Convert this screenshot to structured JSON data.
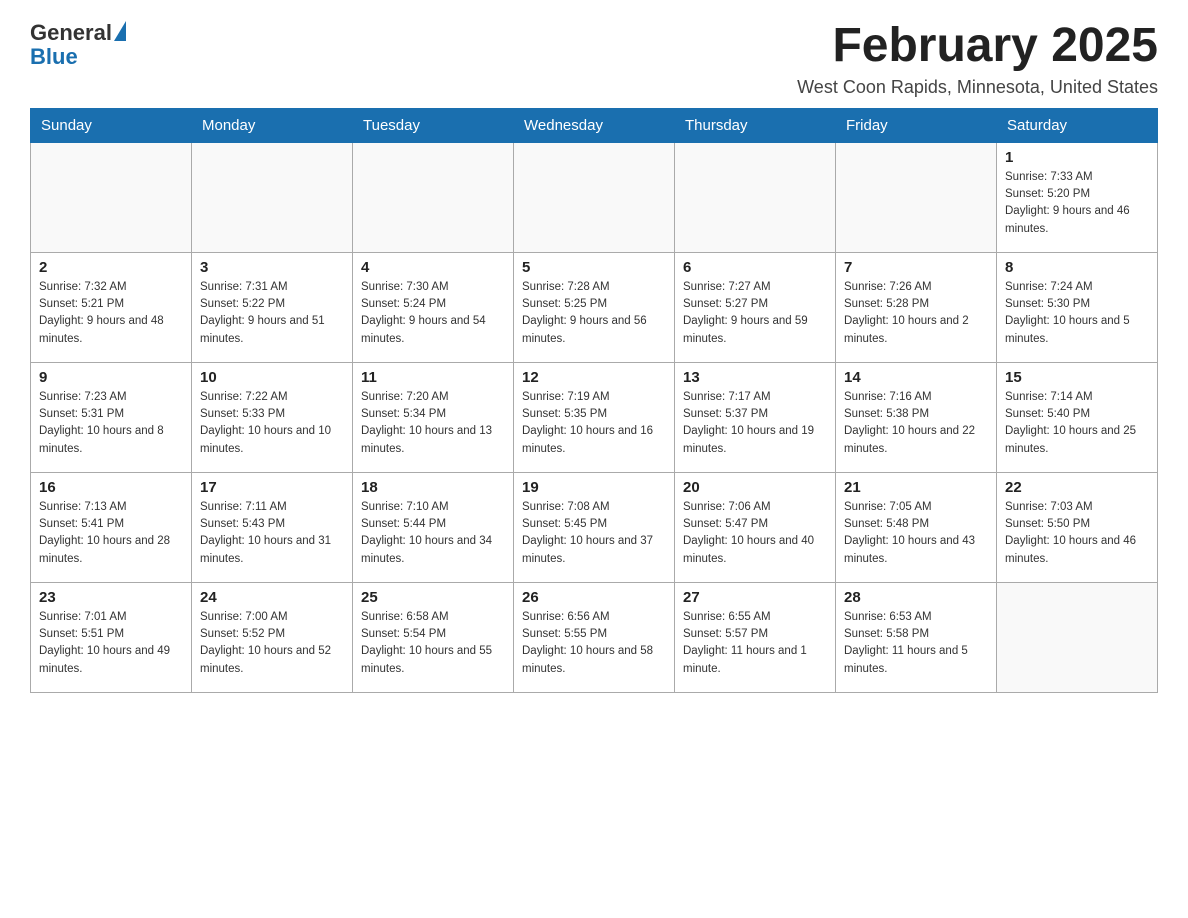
{
  "header": {
    "logo_general": "General",
    "logo_blue": "Blue",
    "month_year": "February 2025",
    "location": "West Coon Rapids, Minnesota, United States"
  },
  "days_of_week": [
    "Sunday",
    "Monday",
    "Tuesday",
    "Wednesday",
    "Thursday",
    "Friday",
    "Saturday"
  ],
  "weeks": [
    [
      {
        "day": "",
        "info": ""
      },
      {
        "day": "",
        "info": ""
      },
      {
        "day": "",
        "info": ""
      },
      {
        "day": "",
        "info": ""
      },
      {
        "day": "",
        "info": ""
      },
      {
        "day": "",
        "info": ""
      },
      {
        "day": "1",
        "info": "Sunrise: 7:33 AM\nSunset: 5:20 PM\nDaylight: 9 hours and 46 minutes."
      }
    ],
    [
      {
        "day": "2",
        "info": "Sunrise: 7:32 AM\nSunset: 5:21 PM\nDaylight: 9 hours and 48 minutes."
      },
      {
        "day": "3",
        "info": "Sunrise: 7:31 AM\nSunset: 5:22 PM\nDaylight: 9 hours and 51 minutes."
      },
      {
        "day": "4",
        "info": "Sunrise: 7:30 AM\nSunset: 5:24 PM\nDaylight: 9 hours and 54 minutes."
      },
      {
        "day": "5",
        "info": "Sunrise: 7:28 AM\nSunset: 5:25 PM\nDaylight: 9 hours and 56 minutes."
      },
      {
        "day": "6",
        "info": "Sunrise: 7:27 AM\nSunset: 5:27 PM\nDaylight: 9 hours and 59 minutes."
      },
      {
        "day": "7",
        "info": "Sunrise: 7:26 AM\nSunset: 5:28 PM\nDaylight: 10 hours and 2 minutes."
      },
      {
        "day": "8",
        "info": "Sunrise: 7:24 AM\nSunset: 5:30 PM\nDaylight: 10 hours and 5 minutes."
      }
    ],
    [
      {
        "day": "9",
        "info": "Sunrise: 7:23 AM\nSunset: 5:31 PM\nDaylight: 10 hours and 8 minutes."
      },
      {
        "day": "10",
        "info": "Sunrise: 7:22 AM\nSunset: 5:33 PM\nDaylight: 10 hours and 10 minutes."
      },
      {
        "day": "11",
        "info": "Sunrise: 7:20 AM\nSunset: 5:34 PM\nDaylight: 10 hours and 13 minutes."
      },
      {
        "day": "12",
        "info": "Sunrise: 7:19 AM\nSunset: 5:35 PM\nDaylight: 10 hours and 16 minutes."
      },
      {
        "day": "13",
        "info": "Sunrise: 7:17 AM\nSunset: 5:37 PM\nDaylight: 10 hours and 19 minutes."
      },
      {
        "day": "14",
        "info": "Sunrise: 7:16 AM\nSunset: 5:38 PM\nDaylight: 10 hours and 22 minutes."
      },
      {
        "day": "15",
        "info": "Sunrise: 7:14 AM\nSunset: 5:40 PM\nDaylight: 10 hours and 25 minutes."
      }
    ],
    [
      {
        "day": "16",
        "info": "Sunrise: 7:13 AM\nSunset: 5:41 PM\nDaylight: 10 hours and 28 minutes."
      },
      {
        "day": "17",
        "info": "Sunrise: 7:11 AM\nSunset: 5:43 PM\nDaylight: 10 hours and 31 minutes."
      },
      {
        "day": "18",
        "info": "Sunrise: 7:10 AM\nSunset: 5:44 PM\nDaylight: 10 hours and 34 minutes."
      },
      {
        "day": "19",
        "info": "Sunrise: 7:08 AM\nSunset: 5:45 PM\nDaylight: 10 hours and 37 minutes."
      },
      {
        "day": "20",
        "info": "Sunrise: 7:06 AM\nSunset: 5:47 PM\nDaylight: 10 hours and 40 minutes."
      },
      {
        "day": "21",
        "info": "Sunrise: 7:05 AM\nSunset: 5:48 PM\nDaylight: 10 hours and 43 minutes."
      },
      {
        "day": "22",
        "info": "Sunrise: 7:03 AM\nSunset: 5:50 PM\nDaylight: 10 hours and 46 minutes."
      }
    ],
    [
      {
        "day": "23",
        "info": "Sunrise: 7:01 AM\nSunset: 5:51 PM\nDaylight: 10 hours and 49 minutes."
      },
      {
        "day": "24",
        "info": "Sunrise: 7:00 AM\nSunset: 5:52 PM\nDaylight: 10 hours and 52 minutes."
      },
      {
        "day": "25",
        "info": "Sunrise: 6:58 AM\nSunset: 5:54 PM\nDaylight: 10 hours and 55 minutes."
      },
      {
        "day": "26",
        "info": "Sunrise: 6:56 AM\nSunset: 5:55 PM\nDaylight: 10 hours and 58 minutes."
      },
      {
        "day": "27",
        "info": "Sunrise: 6:55 AM\nSunset: 5:57 PM\nDaylight: 11 hours and 1 minute."
      },
      {
        "day": "28",
        "info": "Sunrise: 6:53 AM\nSunset: 5:58 PM\nDaylight: 11 hours and 5 minutes."
      },
      {
        "day": "",
        "info": ""
      }
    ]
  ]
}
